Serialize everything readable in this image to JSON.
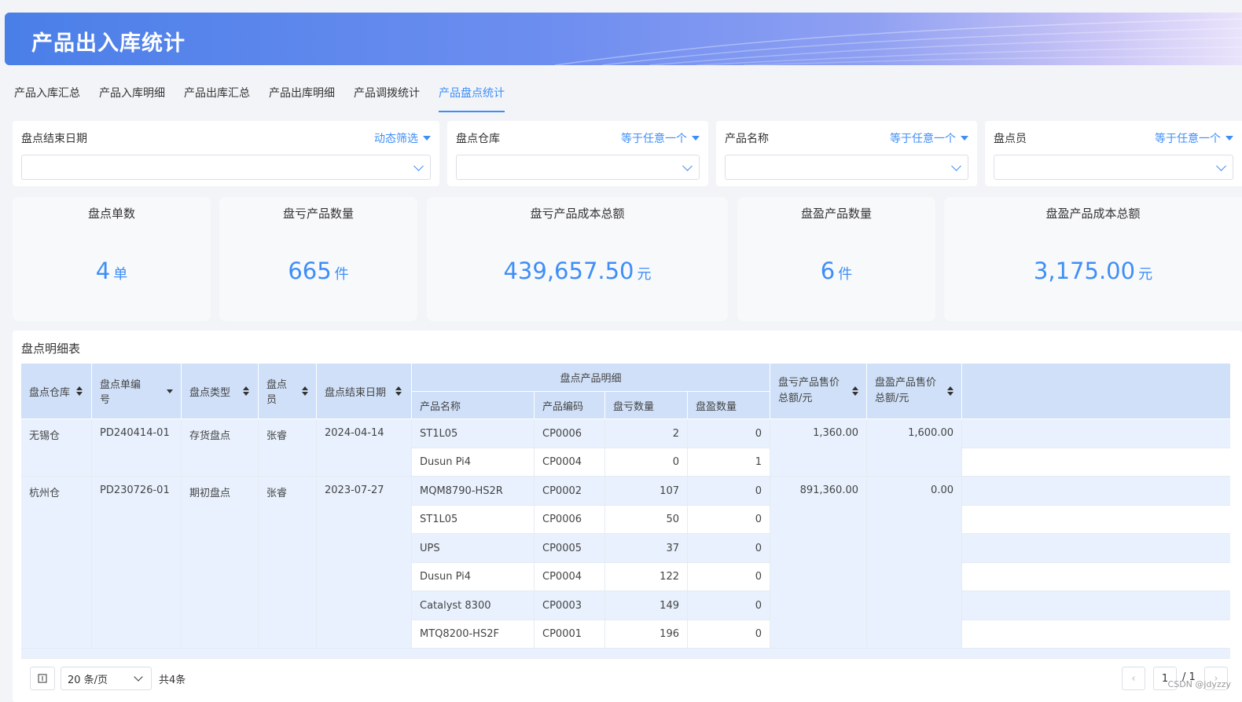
{
  "header": {
    "title": "产品出入库统计"
  },
  "tabs": [
    {
      "label": "产品入库汇总"
    },
    {
      "label": "产品入库明细"
    },
    {
      "label": "产品出库汇总"
    },
    {
      "label": "产品出库明细"
    },
    {
      "label": "产品调拨统计"
    },
    {
      "label": "产品盘点统计",
      "active": true
    }
  ],
  "filters": [
    {
      "label": "盘点结束日期",
      "mode": "动态筛选",
      "value": ""
    },
    {
      "label": "盘点仓库",
      "mode": "等于任意一个",
      "value": ""
    },
    {
      "label": "产品名称",
      "mode": "等于任意一个",
      "value": ""
    },
    {
      "label": "盘点员",
      "mode": "等于任意一个",
      "value": ""
    }
  ],
  "kpis": [
    {
      "label": "盘点单数",
      "value": "4",
      "unit": "单"
    },
    {
      "label": "盘亏产品数量",
      "value": "665",
      "unit": "件"
    },
    {
      "label": "盘亏产品成本总额",
      "value": "439,657.50",
      "unit": "元"
    },
    {
      "label": "盘盈产品数量",
      "value": "6",
      "unit": "件"
    },
    {
      "label": "盘盈产品成本总额",
      "value": "3,175.00",
      "unit": "元"
    }
  ],
  "table": {
    "title": "盘点明细表",
    "headers": {
      "warehouse": "盘点仓库",
      "order_no": "盘点单编号",
      "type": "盘点类型",
      "clerk": "盘点员",
      "end_date": "盘点结束日期",
      "detail_group": "盘点产品明细",
      "product_name": "产品名称",
      "product_code": "产品编码",
      "loss_qty": "盘亏数量",
      "gain_qty": "盘盈数量",
      "loss_amount": "盘亏产品售价总额/元",
      "gain_amount": "盘盈产品售价总额/元"
    },
    "groups": [
      {
        "warehouse": "无锡仓",
        "order_no": "PD240414-01",
        "type": "存货盘点",
        "clerk": "张睿",
        "end_date": "2024-04-14",
        "loss_amount": "1,360.00",
        "gain_amount": "1,600.00",
        "items": [
          {
            "name": "ST1L05",
            "code": "CP0006",
            "loss": "2",
            "gain": "0"
          },
          {
            "name": "Dusun Pi4",
            "code": "CP0004",
            "loss": "0",
            "gain": "1"
          }
        ]
      },
      {
        "warehouse": "杭州仓",
        "order_no": "PD230726-01",
        "type": "期初盘点",
        "clerk": "张睿",
        "end_date": "2023-07-27",
        "loss_amount": "891,360.00",
        "gain_amount": "0.00",
        "items": [
          {
            "name": "MQM8790-HS2R",
            "code": "CP0002",
            "loss": "107",
            "gain": "0"
          },
          {
            "name": "ST1L05",
            "code": "CP0006",
            "loss": "50",
            "gain": "0"
          },
          {
            "name": "UPS",
            "code": "CP0005",
            "loss": "37",
            "gain": "0"
          },
          {
            "name": "Dusun Pi4",
            "code": "CP0004",
            "loss": "122",
            "gain": "0"
          },
          {
            "name": "Catalyst 8300",
            "code": "CP0003",
            "loss": "149",
            "gain": "0"
          },
          {
            "name": "MTQ8200-HS2F",
            "code": "CP0001",
            "loss": "196",
            "gain": "0"
          }
        ]
      }
    ]
  },
  "pager": {
    "page_size": "20 条/页",
    "total": "共4条",
    "current_page": "1",
    "total_pages": "/ 1"
  },
  "watermark": "CSDN @jdyzzy",
  "colors": {
    "accent": "#3e8ef7",
    "header_bg": "#cfe0f8",
    "stripe": "#e8f1fd"
  }
}
